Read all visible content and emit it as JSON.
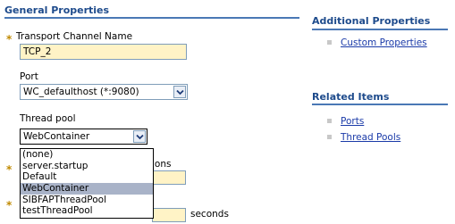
{
  "general": {
    "title": "General Properties",
    "transport_label": "Transport Channel Name",
    "transport_value": "TCP_2",
    "port_label": "Port",
    "port_value": "WC_defaulthost (*:9080)",
    "thread_pool_label": "Thread pool",
    "thread_pool_value": "WebContainer",
    "thread_pool_options": [
      "(none)",
      "server.startup",
      "Default",
      "WebContainer",
      "SIBFAPThreadPool",
      "testThreadPool"
    ],
    "thread_pool_selected_index": 3,
    "obscured_label_tail": "ions",
    "seconds_label": "seconds"
  },
  "additional": {
    "title": "Additional Properties",
    "links": [
      "Custom Properties"
    ]
  },
  "related": {
    "title": "Related Items",
    "links": [
      "Ports",
      "Thread Pools"
    ]
  },
  "colors": {
    "heading": "#1e4b8c",
    "rule": "#4a78b5",
    "required_marker": "#c08a00",
    "input_bg": "#fff3c6",
    "link": "#1a3aa8",
    "selected_option_bg": "#a9b3c8"
  }
}
